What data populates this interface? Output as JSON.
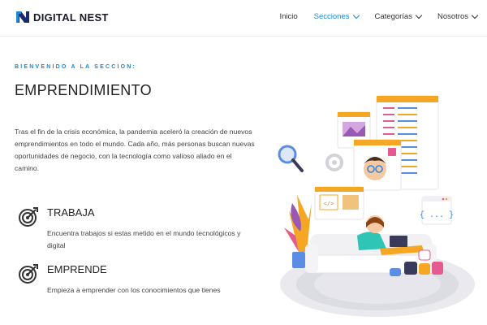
{
  "brand": {
    "name": "DIGITAL NEST",
    "accent": "#1e88d6",
    "dark": "#1a1a2e"
  },
  "nav": {
    "items": [
      {
        "label": "Inicio",
        "active": false,
        "dropdown": false
      },
      {
        "label": "Secciones",
        "active": true,
        "dropdown": true
      },
      {
        "label": "Categorías",
        "active": false,
        "dropdown": true
      },
      {
        "label": "Nosotros",
        "active": false,
        "dropdown": true
      }
    ]
  },
  "hero": {
    "subtitle": "BIENVENIDO A LA SECCION:",
    "title": "EMPRENDIMIENTO",
    "intro": "Tras el fin de la crisis económica, la pandemia aceleró la creación de nuevos emprendimientos en todo el mundo. Cada año, más personas buscan nuevas oportunidades de negocio, con la tecnología como valioso aliado en el camino."
  },
  "features": [
    {
      "icon": "target-icon",
      "title": "TRABAJA",
      "description": "Encuentra trabajos si estas metido en el mundo tecnológicos y digital"
    },
    {
      "icon": "target-icon",
      "title": "EMPRENDE",
      "description": "Empieza a emprender con los conocimientos que tienes"
    }
  ],
  "illustration": {
    "icon": "developer-workspace-illustration",
    "code_symbol": "{ ... }",
    "tag_symbol": "</>"
  }
}
